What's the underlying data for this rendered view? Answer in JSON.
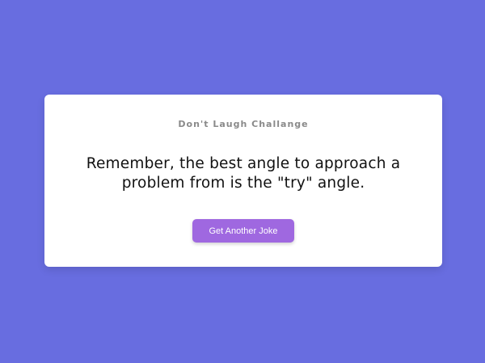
{
  "colors": {
    "background": "#686de0",
    "card": "#ffffff",
    "button": "#9f68e0",
    "title_text": "#8a8a8a",
    "joke_text": "#111111"
  },
  "card": {
    "title": "Don't Laugh Challange",
    "joke": "Remember, the best angle to approach a problem from is the \"try\" angle.",
    "button_label": "Get Another Joke"
  }
}
